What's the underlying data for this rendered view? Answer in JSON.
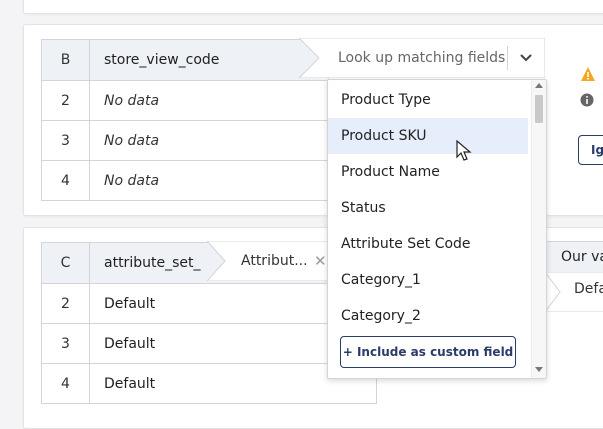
{
  "section_b": {
    "header": {
      "index": "B",
      "column": "store_view_code"
    },
    "rows": [
      {
        "index": "2",
        "value": "No data"
      },
      {
        "index": "3",
        "value": "No data"
      },
      {
        "index": "4",
        "value": "No data"
      }
    ],
    "lookup": {
      "placeholder": "Look up matching fields",
      "icon": "chevron-down-icon"
    },
    "status": {
      "warning_icon": "warning-icon",
      "info_icon": "info-icon",
      "warning_text": "",
      "info_text": ""
    },
    "ignore_button_label": "Ign"
  },
  "dropdown": {
    "options": [
      "Product Type",
      "Product SKU",
      "Product Name",
      "Status",
      "Attribute Set Code",
      "Category_1",
      "Category_2"
    ],
    "active_index": 1,
    "custom_field_label": "+ Include as custom field"
  },
  "section_c": {
    "header": {
      "index": "C",
      "column": "attribute_set_"
    },
    "rows": [
      {
        "index": "2",
        "value": "Default"
      },
      {
        "index": "3",
        "value": "Default"
      },
      {
        "index": "4",
        "value": "Default"
      }
    ],
    "mapped_field": {
      "label": "Attribut...",
      "clear_icon": "close-icon"
    },
    "our_value": {
      "label": "Our va",
      "value": "Defa"
    }
  },
  "colors": {
    "accent": "#2b3b6a",
    "active_option": "#e6eefc",
    "warning": "#f5a623",
    "header_bg": "#eef1f6"
  }
}
